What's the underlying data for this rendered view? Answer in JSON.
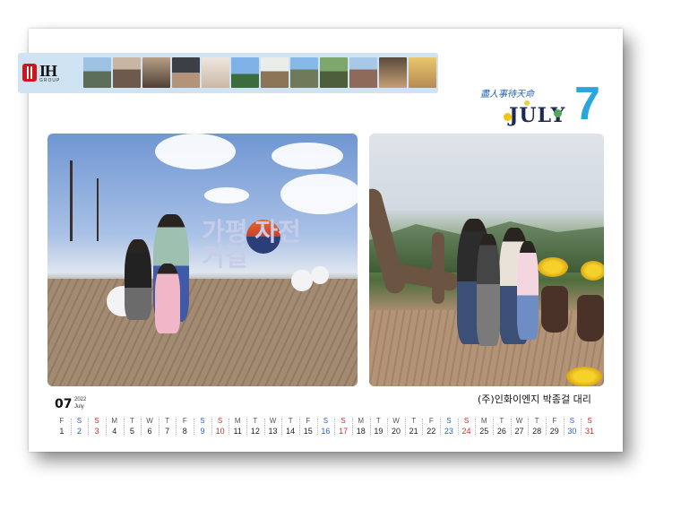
{
  "brand": {
    "name": "IH",
    "sub": "GROUP"
  },
  "motto": "盡人事待天命",
  "month_word": "JULY",
  "month_number": "7",
  "thumbnails": [
    "photo-1",
    "photo-2",
    "photo-3",
    "photo-4",
    "photo-5",
    "photo-6",
    "photo-7",
    "photo-8",
    "photo-9",
    "photo-10",
    "photo-11",
    "photo-12"
  ],
  "sign_text": "가평 자전거길",
  "caption": "(주)인화이엔지 박종걸 대리",
  "calendar": {
    "month": "07",
    "year": "2022",
    "month_name": "July",
    "days": [
      {
        "wd": "F",
        "d": "1",
        "type": "wk"
      },
      {
        "wd": "S",
        "d": "2",
        "type": "sat"
      },
      {
        "wd": "S",
        "d": "3",
        "type": "sun"
      },
      {
        "wd": "M",
        "d": "4",
        "type": "wk"
      },
      {
        "wd": "T",
        "d": "5",
        "type": "wk"
      },
      {
        "wd": "W",
        "d": "6",
        "type": "wk"
      },
      {
        "wd": "T",
        "d": "7",
        "type": "wk"
      },
      {
        "wd": "F",
        "d": "8",
        "type": "wk"
      },
      {
        "wd": "S",
        "d": "9",
        "type": "sat"
      },
      {
        "wd": "S",
        "d": "10",
        "type": "sun"
      },
      {
        "wd": "M",
        "d": "11",
        "type": "wk"
      },
      {
        "wd": "T",
        "d": "12",
        "type": "wk"
      },
      {
        "wd": "W",
        "d": "13",
        "type": "wk"
      },
      {
        "wd": "T",
        "d": "14",
        "type": "wk"
      },
      {
        "wd": "F",
        "d": "15",
        "type": "wk"
      },
      {
        "wd": "S",
        "d": "16",
        "type": "sat"
      },
      {
        "wd": "S",
        "d": "17",
        "type": "sun"
      },
      {
        "wd": "M",
        "d": "18",
        "type": "wk"
      },
      {
        "wd": "T",
        "d": "19",
        "type": "wk"
      },
      {
        "wd": "W",
        "d": "20",
        "type": "wk"
      },
      {
        "wd": "T",
        "d": "21",
        "type": "wk"
      },
      {
        "wd": "F",
        "d": "22",
        "type": "wk"
      },
      {
        "wd": "S",
        "d": "23",
        "type": "sat"
      },
      {
        "wd": "S",
        "d": "24",
        "type": "sun"
      },
      {
        "wd": "M",
        "d": "25",
        "type": "wk"
      },
      {
        "wd": "T",
        "d": "26",
        "type": "wk"
      },
      {
        "wd": "W",
        "d": "27",
        "type": "wk"
      },
      {
        "wd": "T",
        "d": "28",
        "type": "wk"
      },
      {
        "wd": "F",
        "d": "29",
        "type": "wk"
      },
      {
        "wd": "S",
        "d": "30",
        "type": "sat"
      },
      {
        "wd": "S",
        "d": "31",
        "type": "sun"
      }
    ]
  },
  "colors": {
    "saturday": "#2a62c9",
    "sunday": "#d42b2b",
    "accent": "#2aa6dc",
    "brand_red": "#d0141b"
  }
}
